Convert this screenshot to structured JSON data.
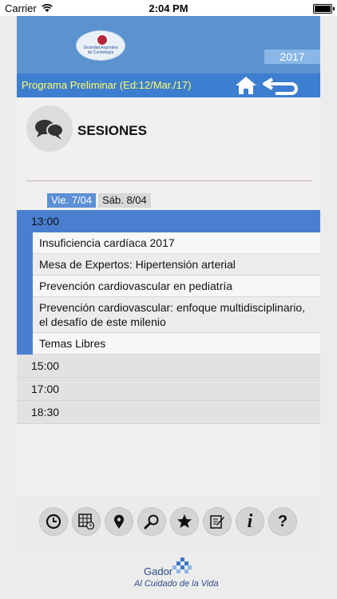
{
  "status": {
    "carrier": "Carrier",
    "time": "2:04 PM"
  },
  "header": {
    "year": "2017",
    "subtitle": "Programa Preliminar (Ed:12/Mar./17)"
  },
  "section": {
    "title": "SESIONES"
  },
  "days": [
    {
      "label": "Vie. 7/04",
      "active": true
    },
    {
      "label": "Sáb. 8/04",
      "active": false
    }
  ],
  "schedule": [
    {
      "time": "13:00",
      "expanded": true,
      "sessions": [
        "Insuficiencia cardíaca 2017",
        "Mesa de Expertos: Hipertensión arterial",
        "Prevención cardiovascular en pediatría",
        "Prevención cardiovascular: enfoque multidisciplinario, el desafío de este milenio",
        "Temas Libres"
      ]
    },
    {
      "time": "15:00",
      "expanded": false
    },
    {
      "time": "17:00",
      "expanded": false
    },
    {
      "time": "18:30",
      "expanded": false
    }
  ],
  "toolbar": {
    "icons": [
      "clock-icon",
      "calendar-grid-icon",
      "location-pin-icon",
      "search-icon",
      "star-icon",
      "notes-icon",
      "info-icon",
      "help-icon"
    ],
    "info_glyph": "i",
    "help_glyph": "?"
  },
  "footer": {
    "brand": "Gador",
    "slogan": "Al Cuidado de la Vida"
  },
  "colors": {
    "banner": "#5b93cf",
    "subheader": "#3d7ed0",
    "subtitle_text": "#ffff66",
    "slot_expanded": "#4a7fd0"
  }
}
